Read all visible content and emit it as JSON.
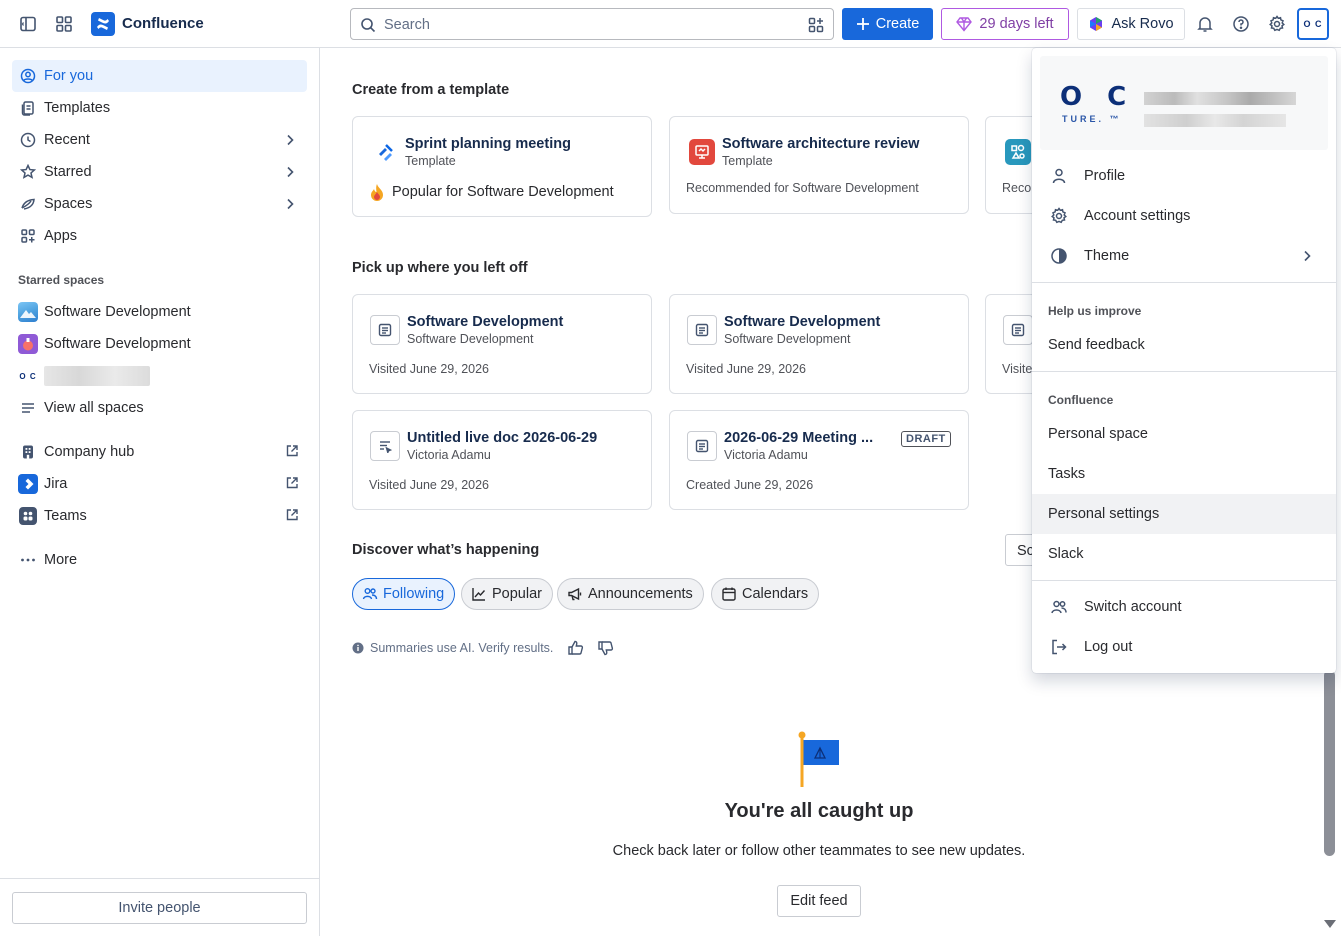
{
  "topbar": {
    "app_name": "Confluence",
    "search_placeholder": "Search",
    "create_label": "Create",
    "trial_label": "29 days left",
    "rovo_label": "Ask Rovo",
    "avatar_initials": "O C"
  },
  "sidebar": {
    "items": [
      {
        "label": "For you",
        "icon": "person-circle-icon"
      },
      {
        "label": "Templates",
        "icon": "template-icon"
      },
      {
        "label": "Recent",
        "icon": "clock-icon"
      },
      {
        "label": "Starred",
        "icon": "star-icon"
      },
      {
        "label": "Spaces",
        "icon": "spaces-icon"
      },
      {
        "label": "Apps",
        "icon": "apps-icon"
      }
    ],
    "starred_heading": "Starred spaces",
    "starred": [
      {
        "label": "Software Development"
      },
      {
        "label": "Software Development"
      }
    ],
    "view_all": "View all spaces",
    "links": [
      {
        "label": "Company hub"
      },
      {
        "label": "Jira"
      },
      {
        "label": "Teams"
      }
    ],
    "more": "More",
    "invite": "Invite people"
  },
  "templates": {
    "heading": "Create from a template",
    "cards": [
      {
        "title": "Sprint planning meeting",
        "sub": "Template",
        "meta": "Popular for Software Development"
      },
      {
        "title": "Software architecture review",
        "sub": "Template",
        "meta": "Recommended for Software Development"
      },
      {
        "meta": "Reco"
      }
    ]
  },
  "recent": {
    "heading": "Pick up where you left off",
    "cards": [
      {
        "title": "Software Development",
        "sub": "Software Development",
        "meta": "Visited June 29, 2026"
      },
      {
        "title": "Software Development",
        "sub": "Software Development",
        "meta": "Visited June 29, 2026"
      },
      {
        "meta": "Visite"
      },
      {
        "title": "Untitled live doc 2026-06-29",
        "sub": "Victoria Adamu",
        "meta": "Visited June 29, 2026"
      },
      {
        "title": "2026-06-29 Meeting ...",
        "sub": "Victoria Adamu",
        "meta": "Created June 29, 2026",
        "badge": "DRAFT"
      }
    ]
  },
  "discover": {
    "heading": "Discover what’s happening",
    "sort_label": "Sc",
    "chips": [
      {
        "label": "Following",
        "selected": true
      },
      {
        "label": "Popular"
      },
      {
        "label": "Announcements"
      },
      {
        "label": "Calendars"
      }
    ],
    "ai_note": "Summaries use AI. Verify results.",
    "empty_title": "You're all caught up",
    "empty_sub": "Check back later or follow other teammates to see new updates.",
    "edit_feed": "Edit feed"
  },
  "menu": {
    "logo_text": "O C",
    "logo_sub": "TURE. ™",
    "items": [
      {
        "label": "Profile",
        "icon": "person-icon"
      },
      {
        "label": "Account settings",
        "icon": "gear-icon"
      },
      {
        "label": "Theme",
        "icon": "contrast-icon"
      }
    ],
    "help_heading": "Help us improve",
    "feedback": "Send feedback",
    "confluence_heading": "Confluence",
    "confluence_items": [
      "Personal space",
      "Tasks",
      "Personal settings",
      "Slack"
    ],
    "switch_account": "Switch account",
    "log_out": "Log out"
  },
  "colors": {
    "accent": "#1868db",
    "trial": "#803fa5"
  }
}
